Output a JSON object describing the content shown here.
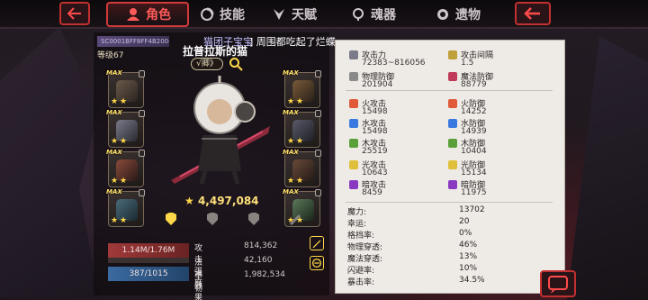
{
  "tabs": [
    {
      "label": "角色",
      "active": true,
      "icon": "character-icon"
    },
    {
      "label": "技能",
      "active": false,
      "icon": "skill-icon"
    },
    {
      "label": "天赋",
      "active": false,
      "icon": "talent-icon"
    },
    {
      "label": "魂器",
      "active": false,
      "icon": "soul-vessel-icon"
    },
    {
      "label": "遗物",
      "active": false,
      "icon": "relic-icon"
    }
  ],
  "colors": {
    "accent": "#d23a3a",
    "panel": "#eeebe6",
    "gold": "#ffd84a"
  },
  "player": {
    "title_strip": "SC0001BFF8FF4B2004",
    "level": "等级67",
    "guild_name": "猫团子宝宝",
    "announcement": "] 周围都吃起了烂蝶.",
    "name": "拉普拉斯的猫",
    "rank_badge": "√卿》",
    "power": "4,497,084"
  },
  "equipment_left": [
    {
      "slot": "helmet",
      "max": "MAX",
      "stars": 2
    },
    {
      "slot": "armor",
      "max": "MAX",
      "stars": 2
    },
    {
      "slot": "gloves",
      "max": "MAX",
      "stars": 2
    },
    {
      "slot": "boots",
      "max": "MAX",
      "stars": 2
    }
  ],
  "equipment_right": [
    {
      "slot": "ring-1",
      "max": "MAX",
      "stars": 2
    },
    {
      "slot": "ring-2",
      "max": "MAX",
      "stars": 2
    },
    {
      "slot": "amulet",
      "max": "MAX",
      "stars": 2
    },
    {
      "slot": "accessory",
      "max": "MAX",
      "stars": 2
    }
  ],
  "bars": {
    "hp": "1.14M/1.76M",
    "mp": "387/1015"
  },
  "bottom_stats": [
    {
      "label": "攻击强度",
      "value": "814,362"
    },
    {
      "label": "法术效果",
      "value": "42,160"
    },
    {
      "label": "坚韧",
      "value": "1,982,534"
    }
  ],
  "stats_left": [
    {
      "label": "攻击力",
      "value": "72383~816056",
      "icon": "sword-icon",
      "color": "#7a7a8a"
    },
    {
      "label": "物理防御",
      "value": "201904",
      "icon": "shield-icon",
      "color": "#8a8a8a"
    },
    {
      "label": "火攻击",
      "value": "15498",
      "icon": "fire-attack-icon",
      "color": "#e05a3a"
    },
    {
      "label": "水攻击",
      "value": "15498",
      "icon": "water-attack-icon",
      "color": "#3a7ae0"
    },
    {
      "label": "木攻击",
      "value": "25519",
      "icon": "wood-attack-icon",
      "color": "#5aa03a"
    },
    {
      "label": "光攻击",
      "value": "10643",
      "icon": "light-attack-icon",
      "color": "#e0c03a"
    },
    {
      "label": "暗攻击",
      "value": "8459",
      "icon": "dark-attack-icon",
      "color": "#8a3ac0"
    }
  ],
  "stats_right": [
    {
      "label": "攻击间隔",
      "value": "1.5",
      "icon": "speed-icon",
      "color": "#c0a03a"
    },
    {
      "label": "魔法防御",
      "value": "88779",
      "icon": "magic-shield-icon",
      "color": "#c03a5a"
    },
    {
      "label": "火防御",
      "value": "14252",
      "icon": "fire-defense-icon",
      "color": "#e05a3a"
    },
    {
      "label": "水防御",
      "value": "14939",
      "icon": "water-defense-icon",
      "color": "#3a7ae0"
    },
    {
      "label": "木防御",
      "value": "10404",
      "icon": "wood-defense-icon",
      "color": "#5aa03a"
    },
    {
      "label": "光防御",
      "value": "15134",
      "icon": "light-defense-icon",
      "color": "#e0c03a"
    },
    {
      "label": "暗防御",
      "value": "11975",
      "icon": "dark-defense-icon",
      "color": "#8a3ac0"
    }
  ],
  "misc_stats": [
    {
      "label": "魔力:",
      "value": "13702"
    },
    {
      "label": "幸运:",
      "value": "20"
    },
    {
      "label": "格挡率:",
      "value": "0%"
    },
    {
      "label": "物理穿透:",
      "value": "46%"
    },
    {
      "label": "魔法穿透:",
      "value": "13%"
    },
    {
      "label": "闪避率:",
      "value": "10%"
    },
    {
      "label": "暴击率:",
      "value": "34.5%"
    }
  ]
}
